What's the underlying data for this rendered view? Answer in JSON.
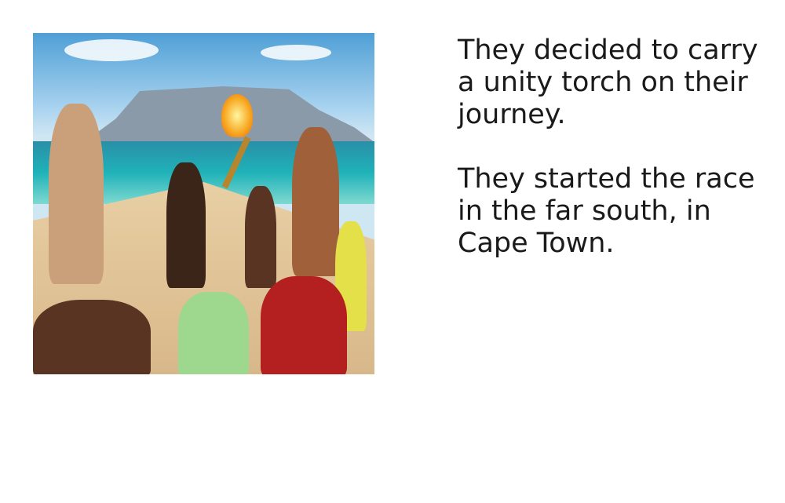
{
  "illustration": {
    "alt_subject": "illustration"
  },
  "paragraphs": [
    "They decided to carry a unity torch on their journey.",
    "They started the race in the far south, in Cape Town."
  ]
}
